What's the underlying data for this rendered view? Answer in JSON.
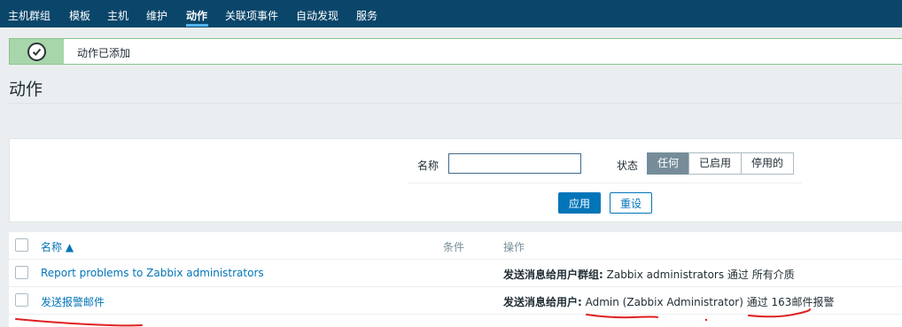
{
  "nav": {
    "items": [
      "主机群组",
      "模板",
      "主机",
      "维护",
      "动作",
      "关联项事件",
      "自动发现",
      "服务"
    ],
    "active": "动作"
  },
  "message": {
    "text": "动作已添加"
  },
  "page": {
    "title": "动作"
  },
  "filter": {
    "name_label": "名称",
    "name_value": "",
    "status_label": "状态",
    "status_options": [
      "任何",
      "已启用",
      "停用的"
    ],
    "status_selected": "任何",
    "apply_label": "应用",
    "reset_label": "重设"
  },
  "table": {
    "headers": {
      "name": "名称 ▲",
      "conditions": "条件",
      "operations": "操作"
    },
    "rows": [
      {
        "name": "Report problems to Zabbix administrators",
        "op_label": "发送消息给用户群组:",
        "op_text": " Zabbix administrators 通过 所有介质"
      },
      {
        "name": "发送报警邮件",
        "op_label": "发送消息给用户:",
        "op_text": " Admin (Zabbix Administrator) 通过 163邮件报警"
      }
    ]
  },
  "colors": {
    "nav_bg": "#0a466a",
    "accent": "#0275b8",
    "success_bg": "#a8d6ab",
    "annotation": "#e02020"
  },
  "icons": [
    "check-icon",
    "sort-up-icon"
  ]
}
